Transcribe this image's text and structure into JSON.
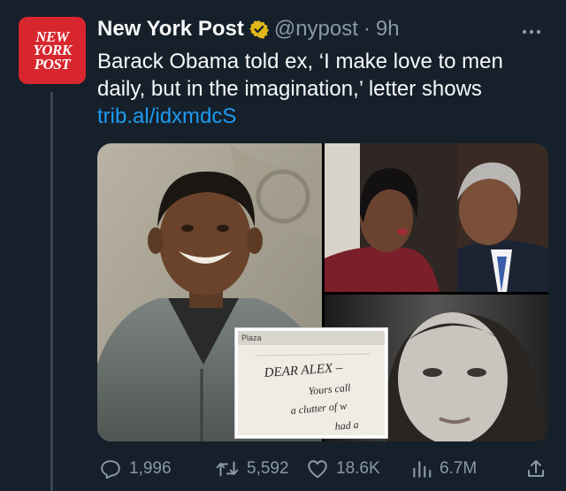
{
  "tweet": {
    "author": {
      "name": "New York Post",
      "handle": "@nypost",
      "separator": "·",
      "time": "9h",
      "avatar_lines": [
        "NEW",
        "YORK",
        "POST"
      ],
      "verified_badge_color": "#e2b719"
    },
    "text": "Barack Obama told ex, ‘I make love to men daily, but in the imagination,’ letter shows",
    "link": "trib.al/idxmdcS",
    "media": {
      "note_lines": [
        "Plaza",
        "DEAR ALEX –",
        "Yours call",
        "a clutter of w",
        "had a"
      ]
    },
    "actions": {
      "replies": "1,996",
      "reposts": "5,592",
      "likes": "18.6K",
      "views": "6.7M"
    }
  },
  "colors": {
    "background": "#15202b",
    "link": "#1d9bf0",
    "secondary_text": "#8b98a5",
    "brand_red": "#d7262e"
  }
}
